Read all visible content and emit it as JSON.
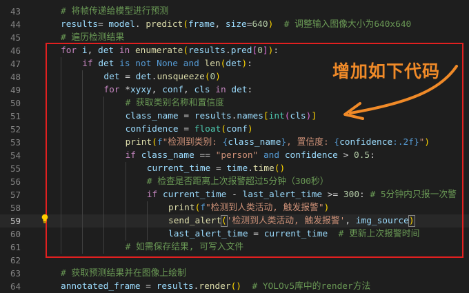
{
  "annotation": "增加如下代码",
  "current_line": 59,
  "lines": [
    {
      "n": "43",
      "indent": 0,
      "tokens": [
        [
          "cm",
          "# 将帧传递给模型进行预测"
        ]
      ]
    },
    {
      "n": "44",
      "indent": 0,
      "tokens": [
        [
          "vr",
          "results"
        ],
        [
          "",
          "="
        ],
        [
          "vr",
          " model"
        ],
        [
          "",
          ". "
        ],
        [
          "fn",
          "predict"
        ],
        [
          "br1",
          "("
        ],
        [
          "vr",
          "frame"
        ],
        [
          "",
          ", "
        ],
        [
          "vr",
          "size"
        ],
        [
          "",
          "="
        ],
        [
          "nm",
          "640"
        ],
        [
          "br1",
          ")"
        ],
        [
          "",
          "  "
        ],
        [
          "cm",
          "# 调整输入图像大小为640x640"
        ]
      ]
    },
    {
      "n": "45",
      "indent": 0,
      "tokens": [
        [
          "cm",
          "# 遍历检测结果"
        ]
      ]
    },
    {
      "n": "46",
      "indent": 0,
      "tokens": [
        [
          "kc",
          "for"
        ],
        [
          "",
          " "
        ],
        [
          "vr",
          "i"
        ],
        [
          "",
          ", "
        ],
        [
          "vr",
          "det"
        ],
        [
          "",
          " "
        ],
        [
          "kc",
          "in"
        ],
        [
          "",
          " "
        ],
        [
          "fn",
          "enumerate"
        ],
        [
          "br1",
          "("
        ],
        [
          "vr",
          "results"
        ],
        [
          "",
          "."
        ],
        [
          "vr",
          "pred"
        ],
        [
          "br2",
          "["
        ],
        [
          "nm",
          "0"
        ],
        [
          "br2",
          "]"
        ],
        [
          "br1",
          ")"
        ],
        [
          "",
          ":"
        ]
      ]
    },
    {
      "n": "47",
      "indent": 1,
      "tokens": [
        [
          "kc",
          "if"
        ],
        [
          "",
          " "
        ],
        [
          "vr",
          "det"
        ],
        [
          "",
          " "
        ],
        [
          "kw",
          "is not"
        ],
        [
          "",
          " "
        ],
        [
          "kw",
          "None"
        ],
        [
          "",
          " "
        ],
        [
          "kw",
          "and"
        ],
        [
          "",
          " "
        ],
        [
          "fn",
          "len"
        ],
        [
          "br1",
          "("
        ],
        [
          "vr",
          "det"
        ],
        [
          "br1",
          ")"
        ],
        [
          "",
          ":"
        ]
      ]
    },
    {
      "n": "48",
      "indent": 2,
      "tokens": [
        [
          "vr",
          "det"
        ],
        [
          "",
          " = "
        ],
        [
          "vr",
          "det"
        ],
        [
          "",
          "."
        ],
        [
          "fn",
          "unsqueeze"
        ],
        [
          "br1",
          "("
        ],
        [
          "nm",
          "0"
        ],
        [
          "br1",
          ")"
        ]
      ]
    },
    {
      "n": "49",
      "indent": 2,
      "tokens": [
        [
          "kc",
          "for"
        ],
        [
          "",
          " *"
        ],
        [
          "vr",
          "xyxy"
        ],
        [
          "",
          ", "
        ],
        [
          "vr",
          "conf"
        ],
        [
          "",
          ", "
        ],
        [
          "vr",
          "cls"
        ],
        [
          "",
          " "
        ],
        [
          "kc",
          "in"
        ],
        [
          "",
          " "
        ],
        [
          "vr",
          "det"
        ],
        [
          "",
          ":"
        ]
      ]
    },
    {
      "n": "50",
      "indent": 3,
      "tokens": [
        [
          "cm",
          "# 获取类别名称和置信度"
        ]
      ]
    },
    {
      "n": "51",
      "indent": 3,
      "tokens": [
        [
          "vr",
          "class_name"
        ],
        [
          "",
          " = "
        ],
        [
          "vr",
          "results"
        ],
        [
          "",
          "."
        ],
        [
          "vr",
          "names"
        ],
        [
          "br1",
          "["
        ],
        [
          "cl",
          "int"
        ],
        [
          "br2",
          "("
        ],
        [
          "vr",
          "cls"
        ],
        [
          "br2",
          ")"
        ],
        [
          "br1",
          "]"
        ]
      ]
    },
    {
      "n": "52",
      "indent": 3,
      "tokens": [
        [
          "vr",
          "confidence"
        ],
        [
          "",
          " = "
        ],
        [
          "cl",
          "float"
        ],
        [
          "br1",
          "("
        ],
        [
          "vr",
          "conf"
        ],
        [
          "br1",
          ")"
        ]
      ]
    },
    {
      "n": "53",
      "indent": 3,
      "tokens": [
        [
          "fn",
          "print"
        ],
        [
          "br1",
          "("
        ],
        [
          "kw",
          "f"
        ],
        [
          "st",
          "\"检测到类别: "
        ],
        [
          "kw",
          "{"
        ],
        [
          "vr",
          "class_name"
        ],
        [
          "kw",
          "}"
        ],
        [
          "st",
          ", 置信度: "
        ],
        [
          "kw",
          "{"
        ],
        [
          "vr",
          "confidence"
        ],
        [
          "kw",
          ":.2f}"
        ],
        [
          "st",
          "\""
        ],
        [
          "br1",
          ")"
        ]
      ]
    },
    {
      "n": "54",
      "indent": 3,
      "tokens": [
        [
          "kc",
          "if"
        ],
        [
          "",
          " "
        ],
        [
          "vr",
          "class_name"
        ],
        [
          "",
          " == "
        ],
        [
          "st",
          "\"person\""
        ],
        [
          "",
          " "
        ],
        [
          "kw",
          "and"
        ],
        [
          "",
          " "
        ],
        [
          "vr",
          "confidence"
        ],
        [
          "",
          " > "
        ],
        [
          "nm",
          "0.5"
        ],
        [
          "",
          ":"
        ]
      ]
    },
    {
      "n": "55",
      "indent": 4,
      "tokens": [
        [
          "vr",
          "current_time"
        ],
        [
          "",
          " = "
        ],
        [
          "vr",
          "time"
        ],
        [
          "",
          "."
        ],
        [
          "fn",
          "time"
        ],
        [
          "br1",
          "()"
        ]
      ]
    },
    {
      "n": "56",
      "indent": 4,
      "tokens": [
        [
          "cm",
          "# 检查是否距离上次报警超过5分钟（300秒）"
        ]
      ]
    },
    {
      "n": "57",
      "indent": 4,
      "tokens": [
        [
          "kc",
          "if"
        ],
        [
          "",
          " "
        ],
        [
          "vr",
          "current_time"
        ],
        [
          "",
          " - "
        ],
        [
          "vr",
          "last_alert_time"
        ],
        [
          "",
          " >= "
        ],
        [
          "nm",
          "300"
        ],
        [
          "",
          ": "
        ],
        [
          "cm",
          "# 5分钟内只报一次警"
        ]
      ]
    },
    {
      "n": "58",
      "indent": 5,
      "tokens": [
        [
          "fn",
          "print"
        ],
        [
          "br1",
          "("
        ],
        [
          "kw",
          "f"
        ],
        [
          "st",
          "\"检测到人类活动, 触发报警\""
        ],
        [
          "br1",
          ")"
        ]
      ]
    },
    {
      "n": "59",
      "indent": 5,
      "tokens": [
        [
          "fn",
          "send_alert"
        ],
        [
          "br1 bm",
          "("
        ],
        [
          "st",
          "'检测到人类活动, 触发报警'"
        ],
        [
          "",
          ", "
        ],
        [
          "vr",
          "img_source"
        ],
        [
          "br1 bm",
          ")"
        ]
      ]
    },
    {
      "n": "60",
      "indent": 5,
      "tokens": [
        [
          "vr",
          "last_alert_time"
        ],
        [
          "",
          " = "
        ],
        [
          "vr",
          "current_time"
        ],
        [
          "",
          "  "
        ],
        [
          "cm",
          "# 更新上次报警时间"
        ]
      ]
    },
    {
      "n": "61",
      "indent": 3,
      "tokens": [
        [
          "cm",
          "# 如需保存结果, 可写入文件"
        ]
      ]
    },
    {
      "n": "62",
      "indent": 0,
      "tokens": []
    },
    {
      "n": "63",
      "indent": 0,
      "tokens": [
        [
          "cm",
          "# 获取预测结果并在图像上绘制"
        ]
      ]
    },
    {
      "n": "64",
      "indent": 0,
      "tokens": [
        [
          "vr",
          "annotated_frame"
        ],
        [
          "",
          " = "
        ],
        [
          "vr",
          "results"
        ],
        [
          "",
          "."
        ],
        [
          "fn",
          "render"
        ],
        [
          "br1",
          "()"
        ],
        [
          "",
          "  "
        ],
        [
          "cm",
          "# YOLOv5库中的render方法"
        ]
      ]
    }
  ]
}
